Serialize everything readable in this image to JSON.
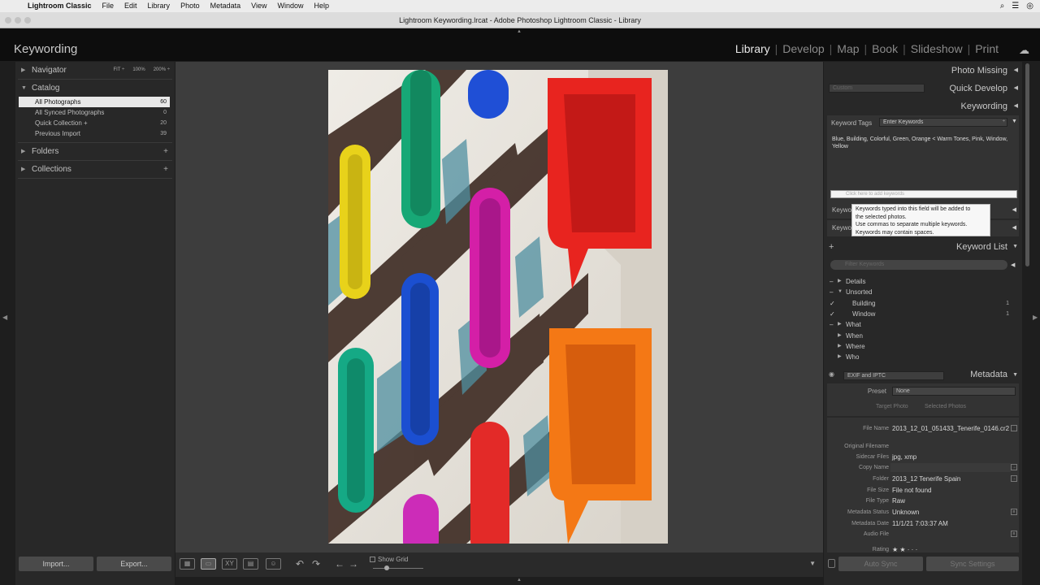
{
  "menubar": {
    "apple": "",
    "app_name": "Lightroom Classic",
    "items": [
      "File",
      "Edit",
      "Library",
      "Photo",
      "Metadata",
      "View",
      "Window",
      "Help"
    ]
  },
  "window": {
    "title": "Lightroom Keywording.lrcat - Adobe Photoshop Lightroom Classic - Library"
  },
  "identity": {
    "title": "Keywording",
    "modules": [
      "Library",
      "Develop",
      "Map",
      "Book",
      "Slideshow",
      "Print"
    ],
    "active_module": "Library",
    "module_sep": "|"
  },
  "navigator": {
    "label": "Navigator",
    "zoom": [
      "FIT ÷",
      "100%",
      "200% ÷"
    ]
  },
  "catalog": {
    "label": "Catalog",
    "items": [
      {
        "name": "All Photographs",
        "count": "60"
      },
      {
        "name": "All Synced Photographs",
        "count": "0"
      },
      {
        "name": "Quick Collection +",
        "count": "20"
      },
      {
        "name": "Previous Import",
        "count": "39"
      }
    ]
  },
  "folders": {
    "label": "Folders"
  },
  "collections": {
    "label": "Collections"
  },
  "buttons": {
    "import": "Import...",
    "export": "Export..."
  },
  "toolbar": {
    "show_grid": "Show Grid"
  },
  "right": {
    "photo_missing": "Photo Missing",
    "quick_develop": "Quick Develop",
    "quick_develop_preset": "Custom",
    "keywording": "Keywording",
    "keyword_tags_label": "Keyword Tags",
    "keyword_tags_mode": "Enter Keywords",
    "keywords_text": "Blue, Building, Colorful, Green, Orange < Warm Tones, Pink, Window, Yellow",
    "keyword_input_placeholder": "Click here to add keywords",
    "tooltip_lines": [
      "Keywords typed into this field will be added to",
      "the selected photos.",
      "Use commas to separate multiple keywords.",
      "Keywords may contain spaces."
    ],
    "keyword_suggestions": "Keyword Suggestions",
    "keyword_set": "Keyword Set",
    "keyword_list": "Keyword List",
    "filter_placeholder": "Filter Keywords",
    "keyword_list_items": [
      {
        "name": "Details",
        "count": ""
      },
      {
        "name": "Unsorted",
        "count": ""
      },
      {
        "name": "Building",
        "count": "1"
      },
      {
        "name": "Window",
        "count": "1"
      },
      {
        "name": "What",
        "count": ""
      },
      {
        "name": "When",
        "count": ""
      },
      {
        "name": "Where",
        "count": ""
      },
      {
        "name": "Who",
        "count": ""
      }
    ],
    "metadata": "Metadata",
    "metadata_view": "EXIF and IPTC",
    "preset_label": "Preset",
    "preset_value": "None",
    "target_photo": "Target Photo",
    "selected_photos": "Selected Photos",
    "fields": [
      {
        "label": "File Name",
        "value": "2013_12_01_051433_Tenerife_0146.cr2"
      },
      {
        "label": "Original Filename",
        "value": ""
      },
      {
        "label": "Sidecar Files",
        "value": "jpg, xmp"
      },
      {
        "label": "Copy Name",
        "value": ""
      },
      {
        "label": "Folder",
        "value": "2013_12 Tenerife Spain"
      },
      {
        "label": "File Size",
        "value": "File not found"
      },
      {
        "label": "File Type",
        "value": "Raw"
      },
      {
        "label": "Metadata Status",
        "value": "Unknown"
      },
      {
        "label": "Metadata Date",
        "value": "11/1/21 7:03:37 AM"
      },
      {
        "label": "Audio File",
        "value": ""
      },
      {
        "label": "Rating",
        "value": "★ ★ · · ·"
      }
    ],
    "auto_sync": "Auto Sync",
    "sync_settings": "Sync Settings"
  },
  "colors": {
    "panel_bg": "#282828",
    "center_bg": "#3d3d3d",
    "identity_bg": "#0d0d0d",
    "selection": "#e8e8e8"
  }
}
